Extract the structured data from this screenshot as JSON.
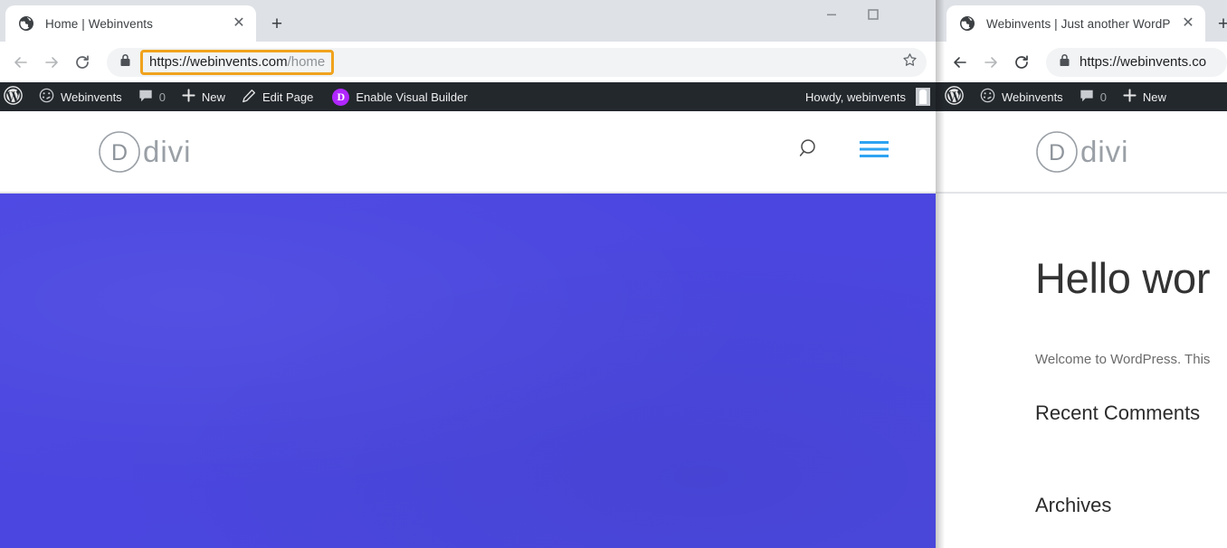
{
  "windows": {
    "back": {
      "tab": {
        "title": "Home | Webinvents",
        "favicon": "globe-icon",
        "close": "✕"
      },
      "newtab_label": "+",
      "controls": {
        "minimize": "minimize-icon",
        "maximize": "maximize-icon"
      },
      "toolbar": {
        "back": "back-arrow-icon",
        "forward": "forward-arrow-icon",
        "reload": "reload-icon",
        "lock": "lock-icon",
        "url_main": "https://webinvents.com",
        "url_path": "/home",
        "url_full": "https://webinvents.com/home",
        "bookmark": "star-icon",
        "highlight_color": "#f0a21c"
      },
      "adminbar": {
        "wp_logo": "wordpress-logo-icon",
        "site_icon": "dashboard-icon",
        "site_name": "Webinvents",
        "comments_icon": "comment-bubble-icon",
        "comments_count": "0",
        "new_icon": "plus-icon",
        "new_label": "New",
        "edit_icon": "pencil-icon",
        "edit_label": "Edit Page",
        "divi_badge": "D",
        "visual_builder_label": "Enable Visual Builder",
        "howdy_label": "Howdy, webinvents",
        "avatar": "user-avatar"
      },
      "site": {
        "logo_letter": "D",
        "logo_word": "divi",
        "search_icon": "search-icon",
        "menu_icon": "hamburger-menu-icon",
        "menu_color": "#2ea3f2",
        "hero_color": "#4a46e0"
      }
    },
    "front": {
      "tab": {
        "title": "Webinvents | Just another WordP",
        "favicon": "globe-icon",
        "close": "✕"
      },
      "newtab_label": "+",
      "toolbar": {
        "back": "back-arrow-icon",
        "forward": "forward-arrow-icon",
        "reload": "reload-icon",
        "lock": "lock-icon",
        "url_main": "https://webinvents.co"
      },
      "adminbar": {
        "wp_logo": "wordpress-logo-icon",
        "site_icon": "dashboard-icon",
        "site_name": "Webinvents",
        "comments_icon": "comment-bubble-icon",
        "comments_count": "0",
        "new_icon": "plus-icon",
        "new_label": "New"
      },
      "site": {
        "logo_letter": "D",
        "logo_word": "divi"
      },
      "content": {
        "post_title": "Hello wor",
        "intro": "Welcome to WordPress. This",
        "heading_recent_comments": "Recent Comments",
        "heading_archives": "Archives"
      }
    }
  }
}
